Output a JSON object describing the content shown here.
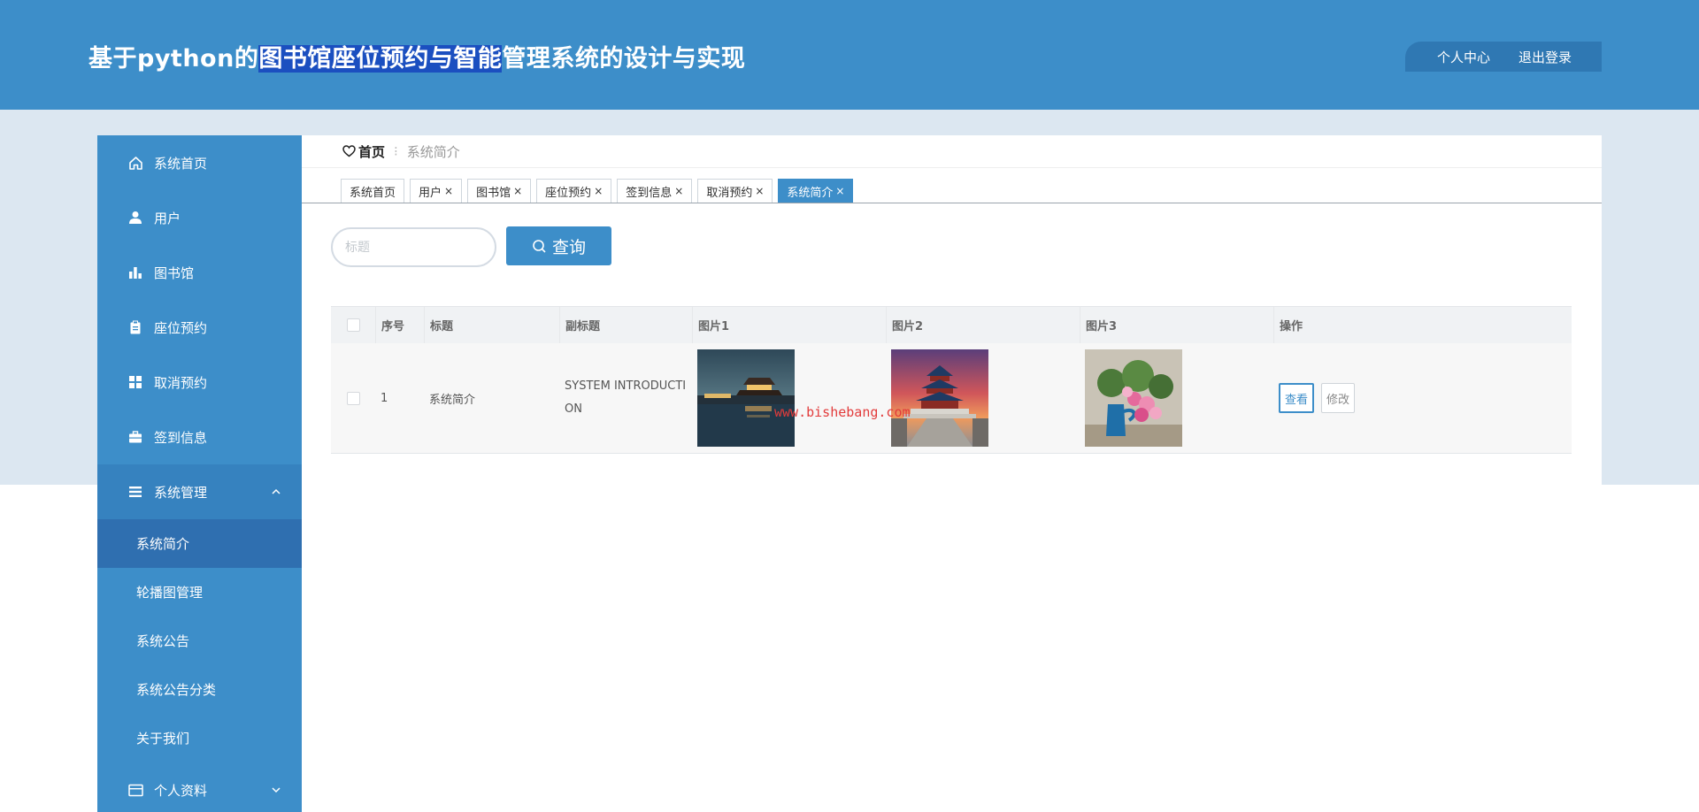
{
  "header": {
    "title_prefix": "基于python的",
    "title_highlight": "图书馆座位预约与智能",
    "title_suffix": "管理系统的设计与实现",
    "links": [
      "个人中心",
      "退出登录"
    ]
  },
  "sidebar": {
    "items": [
      {
        "label": "系统首页",
        "icon": "home-icon"
      },
      {
        "label": "用户",
        "icon": "user-icon"
      },
      {
        "label": "图书馆",
        "icon": "bar-chart-icon"
      },
      {
        "label": "座位预约",
        "icon": "clipboard-icon"
      },
      {
        "label": "取消预约",
        "icon": "grid-icon"
      },
      {
        "label": "签到信息",
        "icon": "briefcase-icon"
      }
    ],
    "group": {
      "label": "系统管理",
      "icon": "list-icon",
      "expanded": true
    },
    "sub_items": [
      "系统简介",
      "轮播图管理",
      "系统公告",
      "系统公告分类",
      "关于我们"
    ],
    "active_sub": "系统简介",
    "profile": {
      "label": "个人资料",
      "icon": "card-icon"
    }
  },
  "breadcrumb": {
    "home": "首页",
    "current": "系统简介"
  },
  "tabs": [
    {
      "label": "系统首页",
      "closable": false,
      "active": false
    },
    {
      "label": "用户",
      "closable": true,
      "active": false
    },
    {
      "label": "图书馆",
      "closable": true,
      "active": false
    },
    {
      "label": "座位预约",
      "closable": true,
      "active": false
    },
    {
      "label": "签到信息",
      "closable": true,
      "active": false
    },
    {
      "label": "取消预约",
      "closable": true,
      "active": false
    },
    {
      "label": "系统简介",
      "closable": true,
      "active": true
    }
  ],
  "tab_close_glyph": "×",
  "search": {
    "placeholder": "标题",
    "button_label": "查询"
  },
  "table": {
    "columns": [
      "",
      "序号",
      "标题",
      "副标题",
      "图片1",
      "图片2",
      "图片3",
      "操作"
    ],
    "rows": [
      {
        "index": "1",
        "title": "系统简介",
        "subtitle": "SYSTEM INTRODUCTION",
        "images": [
          "night-pavilion-photo",
          "temple-of-heaven-photo",
          "pink-flowers-photo"
        ],
        "actions": [
          "查看",
          "修改"
        ]
      }
    ]
  },
  "watermark": "www.bishebang.com",
  "colors": {
    "primary": "#3d8ec9",
    "band": "#dce7f1",
    "active_sub": "#2f6fb0",
    "highlight": "#1b4fc0"
  }
}
